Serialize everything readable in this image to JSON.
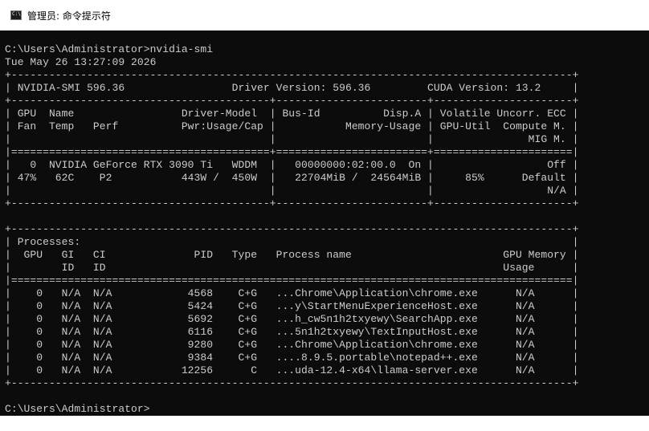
{
  "window": {
    "title": "管理员: 命令提示符",
    "icon_name": "cmd-icon",
    "icon_glyph": "C:\\"
  },
  "console": {
    "lines": [
      "C:\\Users\\Administrator>nvidia-smi",
      "Tue May 26 13:27:09 2026",
      "+-----------------------------------------------------------------------------------------+",
      "| NVIDIA-SMI 596.36                 Driver Version: 596.36         CUDA Version: 13.2     |",
      "+-----------------------------------------+------------------------+----------------------+",
      "| GPU  Name                 Driver-Model  | Bus-Id          Disp.A | Volatile Uncorr. ECC |",
      "| Fan  Temp   Perf          Pwr:Usage/Cap |           Memory-Usage | GPU-Util  Compute M. |",
      "|                                         |                        |               MIG M. |",
      "|=========================================+========================+======================|",
      "|   0  NVIDIA GeForce RTX 3090 Ti   WDDM  |   00000000:02:00.0  On |                  Off |",
      "| 47%   62C    P2           443W /  450W  |   22704MiB /  24564MiB |     85%      Default |",
      "|                                         |                        |                  N/A |",
      "+-----------------------------------------+------------------------+----------------------+",
      "",
      "+-----------------------------------------------------------------------------------------+",
      "| Processes:                                                                              |",
      "|  GPU   GI   CI              PID   Type   Process name                        GPU Memory |",
      "|        ID   ID                                                               Usage      |",
      "|=========================================================================================|",
      "|    0   N/A  N/A            4568    C+G   ...Chrome\\Application\\chrome.exe      N/A      |",
      "|    0   N/A  N/A            5424    C+G   ...y\\StartMenuExperienceHost.exe      N/A      |",
      "|    0   N/A  N/A            5692    C+G   ...h_cw5n1h2txyewy\\SearchApp.exe      N/A      |",
      "|    0   N/A  N/A            6116    C+G   ...5n1h2txyewy\\TextInputHost.exe      N/A      |",
      "|    0   N/A  N/A            9280    C+G   ...Chrome\\Application\\chrome.exe      N/A      |",
      "|    0   N/A  N/A            9384    C+G   ....8.9.5.portable\\notepad++.exe      N/A      |",
      "|    0   N/A  N/A           12256      C   ...uda-12.4-x64\\llama-server.exe      N/A      |",
      "+-----------------------------------------------------------------------------------------+",
      "",
      "C:\\Users\\Administrator>"
    ]
  },
  "colors": {
    "console_bg": "#0c0c0c",
    "console_fg": "#cccccc",
    "titlebar_bg": "#ffffff"
  }
}
